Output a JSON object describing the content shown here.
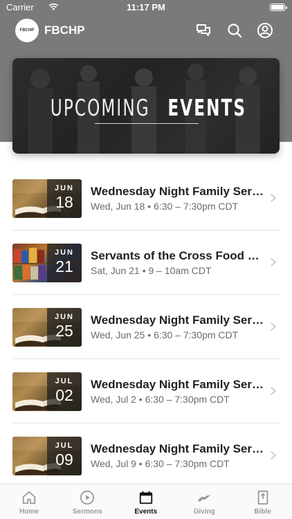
{
  "status_bar": {
    "carrier": "Carrier",
    "time": "11:17 PM"
  },
  "app": {
    "logo_text": "FBCHP",
    "title": "FBCHP"
  },
  "banner": {
    "light": "UPCOMING",
    "bold": "EVENTS"
  },
  "events": [
    {
      "thumb": "bible",
      "month": "JUN",
      "day": "18",
      "title": "Wednesday Night Family Servi...",
      "time": "Wed, Jun 18 • 6:30 – 7:30pm CDT"
    },
    {
      "thumb": "food",
      "month": "JUN",
      "day": "21",
      "title": "Servants of the Cross Food Mi...",
      "time": "Sat, Jun 21 • 9 – 10am CDT"
    },
    {
      "thumb": "bible",
      "month": "JUN",
      "day": "25",
      "title": "Wednesday Night Family Servi...",
      "time": "Wed, Jun 25 • 6:30 – 7:30pm CDT"
    },
    {
      "thumb": "bible",
      "month": "JUL",
      "day": "02",
      "title": "Wednesday Night Family Servi...",
      "time": "Wed, Jul 2 • 6:30 – 7:30pm CDT"
    },
    {
      "thumb": "bible",
      "month": "JUL",
      "day": "09",
      "title": "Wednesday Night Family Servi...",
      "time": "Wed, Jul 9 • 6:30 – 7:30pm CDT"
    }
  ],
  "tabs": [
    {
      "label": "Home",
      "icon": "home-icon"
    },
    {
      "label": "Sermons",
      "icon": "play-circle-icon"
    },
    {
      "label": "Events",
      "icon": "calendar-icon",
      "active": true
    },
    {
      "label": "Giving",
      "icon": "giving-hand-icon"
    },
    {
      "label": "Bible",
      "icon": "bible-icon"
    }
  ],
  "colors": {
    "header": "#7a7a7a",
    "tab_active": "#111111",
    "tab_inactive": "#9a9a9a"
  }
}
